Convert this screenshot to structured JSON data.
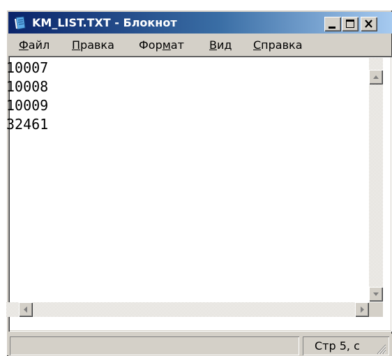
{
  "window": {
    "title": "KM_LIST.TXT - Блокнот",
    "icon": "notepad-icon",
    "controls": [
      "minimize-icon",
      "maximize-icon",
      "close-icon"
    ]
  },
  "menu": {
    "items": [
      {
        "label": "Файл",
        "accel": "Ф",
        "rest": "айл"
      },
      {
        "label": "Правка",
        "accel": "П",
        "rest": "равка"
      },
      {
        "label": "Формат",
        "pre": "Фор",
        "accel": "м",
        "rest": "ат"
      },
      {
        "label": "Вид",
        "accel": "В",
        "rest": "ид"
      },
      {
        "label": "Справка",
        "accel": "С",
        "rest": "правка"
      }
    ]
  },
  "editor": {
    "lines": [
      "10007",
      "10008",
      "10009",
      "32461"
    ]
  },
  "status": {
    "position": "Стр 5, с"
  },
  "colors": {
    "title_gradient_start": "#0a246a",
    "title_gradient_end": "#a6caf0",
    "face": "#d4d0c8"
  }
}
